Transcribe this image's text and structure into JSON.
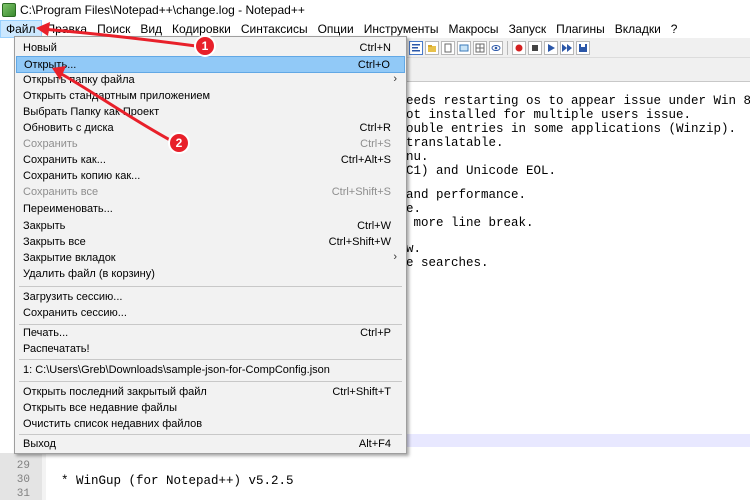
{
  "window": {
    "title": "C:\\Program Files\\Notepad++\\change.log - Notepad++"
  },
  "menubar": [
    {
      "label": "Файл",
      "active": true
    },
    {
      "label": "Правка"
    },
    {
      "label": "Поиск"
    },
    {
      "label": "Вид"
    },
    {
      "label": "Кодировки"
    },
    {
      "label": "Синтаксисы"
    },
    {
      "label": "Опции"
    },
    {
      "label": "Инструменты"
    },
    {
      "label": "Макросы"
    },
    {
      "label": "Запуск"
    },
    {
      "label": "Плагины"
    },
    {
      "label": "Вкладки"
    },
    {
      "label": "?"
    }
  ],
  "file_menu": {
    "items": [
      {
        "label": "Новый",
        "shortcut": "Ctrl+N"
      },
      {
        "label": "Открыть...",
        "shortcut": "Ctrl+O",
        "highlighted": true
      },
      {
        "label": "Открыть папку файла",
        "submenu": true
      },
      {
        "label": "Открыть стандартным приложением"
      },
      {
        "label": "Выбрать Папку как Проект"
      },
      {
        "label": "Обновить с диска",
        "shortcut": "Ctrl+R"
      },
      {
        "label": "Сохранить",
        "shortcut": "Ctrl+S",
        "disabled": true
      },
      {
        "label": "Сохранить как...",
        "shortcut": "Ctrl+Alt+S"
      },
      {
        "label": "Сохранить копию как..."
      },
      {
        "label": "Сохранить все",
        "shortcut": "Ctrl+Shift+S",
        "disabled": true
      },
      {
        "label": "Переименовать..."
      },
      {
        "label": "Закрыть",
        "shortcut": "Ctrl+W"
      },
      {
        "label": "Закрыть все",
        "shortcut": "Ctrl+Shift+W"
      },
      {
        "label": "Закрытие вкладок",
        "submenu": true
      },
      {
        "label": "Удалить файл (в корзину)"
      },
      {
        "label": "Загрузить сессию..."
      },
      {
        "label": "Сохранить сессию..."
      },
      {
        "label": "Печать...",
        "shortcut": "Ctrl+P"
      },
      {
        "label": "Распечатать!"
      },
      {
        "label": "1: C:\\Users\\Greb\\Downloads\\sample-json-for-CompConfig.json"
      },
      {
        "label": "Открыть последний закрытый файл",
        "shortcut": "Ctrl+Shift+T"
      },
      {
        "label": "Открыть все недавние файлы"
      },
      {
        "label": "Очистить список недавних файлов"
      },
      {
        "label": "Выход",
        "shortcut": "Alt+F4"
      }
    ]
  },
  "editor": {
    "visible_fragments": [
      "eeds restarting os to appear issue under Win 8/10.",
      "ot installed for multiple users issue.",
      "ouble entries in some applications (Winzip).",
      "translatable.",
      "nu.",
      "C1) and Unicode EOL.",
      "and performance.",
      "e.",
      " more line break.",
      "w.",
      "e searches."
    ],
    "bottom_lines": [
      {
        "number": "29",
        "text": ""
      },
      {
        "number": "30",
        "text": "  * WinGup (for Notepad++) v5.2.5"
      },
      {
        "number": "31",
        "text": ""
      }
    ]
  },
  "annotations": [
    {
      "number": "1",
      "color": "#e8202a"
    },
    {
      "number": "2",
      "color": "#e8202a"
    }
  ]
}
